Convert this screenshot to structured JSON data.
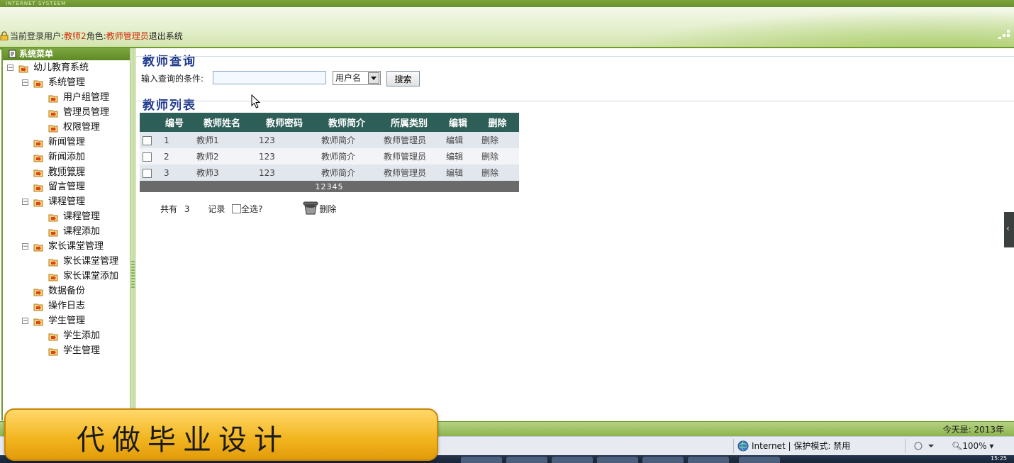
{
  "header": {
    "system_tag": "INTERNET SYSTEEM",
    "login_prefix": "当前登录用户:",
    "username": "教师2",
    "role_prefix": "角色:",
    "role": "教师管理员",
    "logout_label": "退出系统"
  },
  "sidebar": {
    "title": "系统菜单",
    "items": [
      {
        "label": "幼儿教育系统"
      },
      {
        "label": "系统管理"
      },
      {
        "label": "用户组管理"
      },
      {
        "label": "管理员管理"
      },
      {
        "label": "权限管理"
      },
      {
        "label": "新闻管理"
      },
      {
        "label": "新闻添加"
      },
      {
        "label": "教师管理"
      },
      {
        "label": "留言管理"
      },
      {
        "label": "课程管理"
      },
      {
        "label": "课程管理"
      },
      {
        "label": "课程添加"
      },
      {
        "label": "家长课堂管理"
      },
      {
        "label": "家长课堂管理"
      },
      {
        "label": "家长课堂添加"
      },
      {
        "label": "数据备份"
      },
      {
        "label": "操作日志"
      },
      {
        "label": "学生管理"
      },
      {
        "label": "学生添加"
      },
      {
        "label": "学生管理"
      }
    ]
  },
  "query": {
    "title": "教师查询",
    "label": "输入查询的条件:",
    "input_value": "",
    "select_value": "用户名",
    "search_label": "搜索"
  },
  "list": {
    "title": "教师列表",
    "columns": [
      "编号",
      "教师姓名",
      "教师密码",
      "教师简介",
      "所属类别",
      "编辑",
      "删除"
    ],
    "rows": [
      {
        "id": "1",
        "name": "教师1",
        "password": "123",
        "intro": "教师简介",
        "category": "教师管理员",
        "edit": "编辑",
        "delete": "删除"
      },
      {
        "id": "2",
        "name": "教师2",
        "password": "123",
        "intro": "教师简介",
        "category": "教师管理员",
        "edit": "编辑",
        "delete": "删除"
      },
      {
        "id": "3",
        "name": "教师3",
        "password": "123",
        "intro": "教师简介",
        "category": "教师管理员",
        "edit": "编辑",
        "delete": "删除"
      }
    ],
    "pager": "12345",
    "footer": {
      "total_prefix": "共有",
      "total": "3",
      "total_suffix": "记录",
      "select_all": "全选?",
      "delete_label": "删除"
    }
  },
  "status": {
    "date": "今天是: 2013年"
  },
  "browser": {
    "zone": "Internet | 保护模式: 禁用",
    "zoom": "100%",
    "clock": "15:25"
  },
  "overlay": {
    "banner_text": "代做毕业设计"
  },
  "colors": {
    "theme_green": "#6f9a2e",
    "table_header": "#2e5e58",
    "title_blue": "#1f3a8c",
    "highlight_red": "#d12f0a"
  }
}
